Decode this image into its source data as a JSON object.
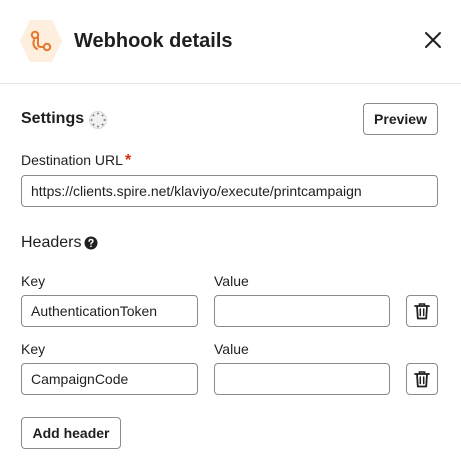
{
  "header": {
    "title": "Webhook details",
    "icon": "webhook-icon",
    "accent_color": "#f2994a",
    "icon_bg_color": "#fdeedd"
  },
  "settings": {
    "title": "Settings",
    "preview_label": "Preview"
  },
  "destination": {
    "label": "Destination URL",
    "required_mark": "*",
    "value": "https://clients.spire.net/klaviyo/execute/printcampaign"
  },
  "headers": {
    "title": "Headers",
    "rows": [
      {
        "key_label": "Key",
        "value_label": "Value",
        "key": "AuthenticationToken",
        "value": ""
      },
      {
        "key_label": "Key",
        "value_label": "Value",
        "key": "CampaignCode",
        "value": ""
      }
    ],
    "add_label": "Add header"
  }
}
